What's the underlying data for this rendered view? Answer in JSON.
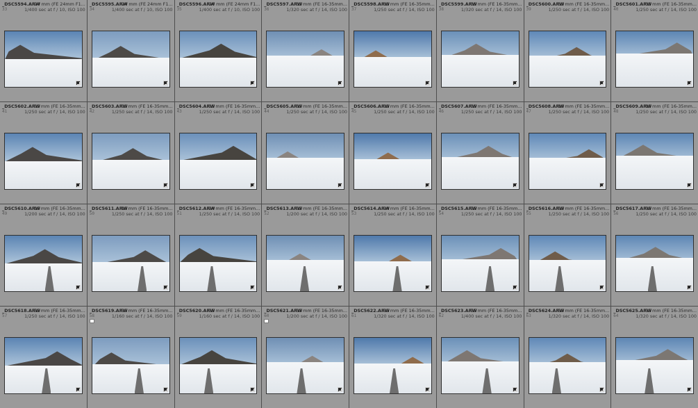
{
  "cells": [
    {
      "file": "_DSC5594.ARW",
      "info": "24 mm (FE 24mm F1...",
      "index": "33",
      "exposure": "1/400 sec at f / 10, ISO 100",
      "flag": false
    },
    {
      "file": "_DSC5595.ARW",
      "info": "24 mm (FE 24mm F1...",
      "index": "34",
      "exposure": "1/400 sec at f / 10, ISO 100",
      "flag": false
    },
    {
      "file": "_DSC5596.ARW",
      "info": "24 mm (FE 24mm F1...",
      "index": "35",
      "exposure": "1/400 sec at f / 10, ISO 100",
      "flag": false
    },
    {
      "file": "_DSC5597.ARW",
      "info": "35 mm (FE 16-35mm...",
      "index": "36",
      "exposure": "1/320 sec at f / 14, ISO 100",
      "flag": false
    },
    {
      "file": "_DSC5598.ARW",
      "info": "35 mm (FE 16-35mm...",
      "index": "37",
      "exposure": "1/250 sec at f / 14, ISO 100",
      "flag": false
    },
    {
      "file": "_DSC5599.ARW",
      "info": "35 mm (FE 16-35mm...",
      "index": "38",
      "exposure": "1/320 sec at f / 14, ISO 100",
      "flag": false
    },
    {
      "file": "_DSC5600.ARW",
      "info": "35 mm (FE 16-35mm...",
      "index": "39",
      "exposure": "1/250 sec at f / 14, ISO 100",
      "flag": false
    },
    {
      "file": "_DSC5601.ARW",
      "info": "35 mm (FE 16-35mm...",
      "index": "40",
      "exposure": "1/250 sec at f / 14, ISO 100",
      "flag": false
    },
    {
      "file": "_DSC5602.ARW",
      "info": "35 mm (FE 16-35mm...",
      "index": "41",
      "exposure": "1/250 sec at f / 14, ISO 100",
      "flag": false
    },
    {
      "file": "_DSC5603.ARW",
      "info": "35 mm (FE 16-35mm...",
      "index": "42",
      "exposure": "1/250 sec at f / 14, ISO 100",
      "flag": false
    },
    {
      "file": "_DSC5604.ARW",
      "info": "35 mm (FE 16-35mm...",
      "index": "43",
      "exposure": "1/250 sec at f / 14, ISO 100",
      "flag": false
    },
    {
      "file": "_DSC5605.ARW",
      "info": "35 mm (FE 16-35mm...",
      "index": "44",
      "exposure": "1/250 sec at f / 14, ISO 100",
      "flag": false
    },
    {
      "file": "_DSC5606.ARW",
      "info": "35 mm (FE 16-35mm...",
      "index": "45",
      "exposure": "1/250 sec at f / 14, ISO 100",
      "flag": false
    },
    {
      "file": "_DSC5607.ARW",
      "info": "35 mm (FE 16-35mm...",
      "index": "46",
      "exposure": "1/250 sec at f / 14, ISO 100",
      "flag": false
    },
    {
      "file": "_DSC5608.ARW",
      "info": "16 mm (FE 16-35mm...",
      "index": "47",
      "exposure": "1/250 sec at f / 14, ISO 100",
      "flag": false
    },
    {
      "file": "_DSC5609.ARW",
      "info": "16 mm (FE 16-35mm...",
      "index": "48",
      "exposure": "1/250 sec at f / 14, ISO 100",
      "flag": false
    },
    {
      "file": "_DSC5610.ARW",
      "info": "16 mm (FE 16-35mm...",
      "index": "49",
      "exposure": "1/200 sec at f / 14, ISO 100",
      "flag": false
    },
    {
      "file": "_DSC5611.ARW",
      "info": "16 mm (FE 16-35mm...",
      "index": "50",
      "exposure": "1/250 sec at f / 14, ISO 100",
      "flag": false
    },
    {
      "file": "_DSC5612.ARW",
      "info": "24 mm (FE 16-35mm...",
      "index": "51",
      "exposure": "1/250 sec at f / 14, ISO 100",
      "flag": false
    },
    {
      "file": "_DSC5613.ARW",
      "info": "35 mm (FE 16-35mm...",
      "index": "52",
      "exposure": "1/200 sec at f / 14, ISO 100",
      "flag": false
    },
    {
      "file": "_DSC5614.ARW",
      "info": "24 mm (FE 16-35mm...",
      "index": "53",
      "exposure": "1/250 sec at f / 14, ISO 100",
      "flag": false
    },
    {
      "file": "_DSC5615.ARW",
      "info": "35 mm (FE 16-35mm...",
      "index": "54",
      "exposure": "1/250 sec at f / 14, ISO 100",
      "flag": false
    },
    {
      "file": "_DSC5616.ARW",
      "info": "35 mm (FE 16-35mm...",
      "index": "55",
      "exposure": "1/250 sec at f / 14, ISO 100",
      "flag": false
    },
    {
      "file": "_DSC5617.ARW",
      "info": "35 mm (FE 16-35mm...",
      "index": "56",
      "exposure": "1/250 sec at f / 14, ISO 100",
      "flag": false
    },
    {
      "file": "_DSC5618.ARW",
      "info": "35 mm (FE 16-35mm...",
      "index": "57",
      "exposure": "1/250 sec at f / 14, ISO 100",
      "flag": false
    },
    {
      "file": "_DSC5619.ARW",
      "info": "35 mm (FE 16-35mm...",
      "index": "58",
      "exposure": "1/160 sec at f / 14, ISO 100",
      "flag": true
    },
    {
      "file": "_DSC5620.ARW",
      "info": "35 mm (FE 16-35mm...",
      "index": "59",
      "exposure": "1/160 sec at f / 14, ISO 100",
      "flag": false
    },
    {
      "file": "_DSC5621.ARW",
      "info": "35 mm (FE 16-35mm...",
      "index": "60",
      "exposure": "1/200 sec at f / 14, ISO 100",
      "flag": true
    },
    {
      "file": "_DSC5622.ARW",
      "info": "35 mm (FE 16-35mm...",
      "index": "61",
      "exposure": "1/320 sec at f / 14, ISO 100",
      "flag": false
    },
    {
      "file": "_DSC5623.ARW",
      "info": "35 mm (FE 16-35mm...",
      "index": "62",
      "exposure": "1/400 sec at f / 14, ISO 100",
      "flag": false
    },
    {
      "file": "_DSC5624.ARW",
      "info": "35 mm (FE 16-35mm...",
      "index": "63",
      "exposure": "1/320 sec at f / 14, ISO 100",
      "flag": false
    },
    {
      "file": "_DSC5625.ARW",
      "info": "35 mm (FE 16-35mm...",
      "index": "64",
      "exposure": "1/320 sec at f / 14, ISO 100",
      "flag": false
    }
  ],
  "colors": {
    "cell_background": "#9a9a9a",
    "grid_gap": "#4d4d4d",
    "filename_text": "#242424",
    "index_text": "#5a5a5a",
    "flag": "#ffffff"
  }
}
